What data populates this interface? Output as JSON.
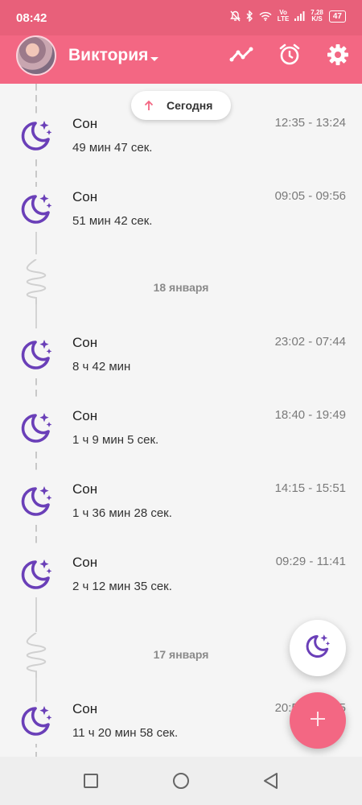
{
  "status_bar": {
    "time": "08:42",
    "network_type_top": "Vo",
    "network_type_bottom": "LTE",
    "speed_value": "7,28",
    "speed_unit": "K/S",
    "battery": "47"
  },
  "header": {
    "profile_name": "Виктория",
    "icons": [
      "chart-icon",
      "alarm-icon",
      "gear-icon"
    ]
  },
  "timeline": {
    "scroll_button_label": "Сегодня",
    "groups": [
      {
        "date_label": "",
        "entries": [
          {
            "title": "Сон",
            "time_range": "12:35 - 13:24",
            "duration": "49 мин 47 сек."
          },
          {
            "title": "Сон",
            "time_range": "09:05 - 09:56",
            "duration": "51 мин 42 сек."
          }
        ]
      },
      {
        "date_label": "18 января",
        "entries": [
          {
            "title": "Сон",
            "time_range": "23:02 - 07:44",
            "duration": "8 ч 42 мин"
          },
          {
            "title": "Сон",
            "time_range": "18:40 - 19:49",
            "duration": "1 ч 9 мин 5 сек."
          },
          {
            "title": "Сон",
            "time_range": "14:15 - 15:51",
            "duration": "1 ч 36 мин 28 сек."
          },
          {
            "title": "Сон",
            "time_range": "09:29 - 11:41",
            "duration": "2 ч 12 мин 35 сек."
          }
        ]
      },
      {
        "date_label": "17 января",
        "entries": [
          {
            "title": "Сон",
            "time_range": "20:55 - 08:15",
            "duration": "11 ч 20 мин 58 сек."
          }
        ]
      }
    ]
  },
  "fabs": {
    "sleep_icon": "moon-stars-icon",
    "add_icon": "plus-icon"
  },
  "colors": {
    "accent": "#f36783",
    "status_bar": "#e8607a",
    "moon": "#6a3fb8"
  }
}
